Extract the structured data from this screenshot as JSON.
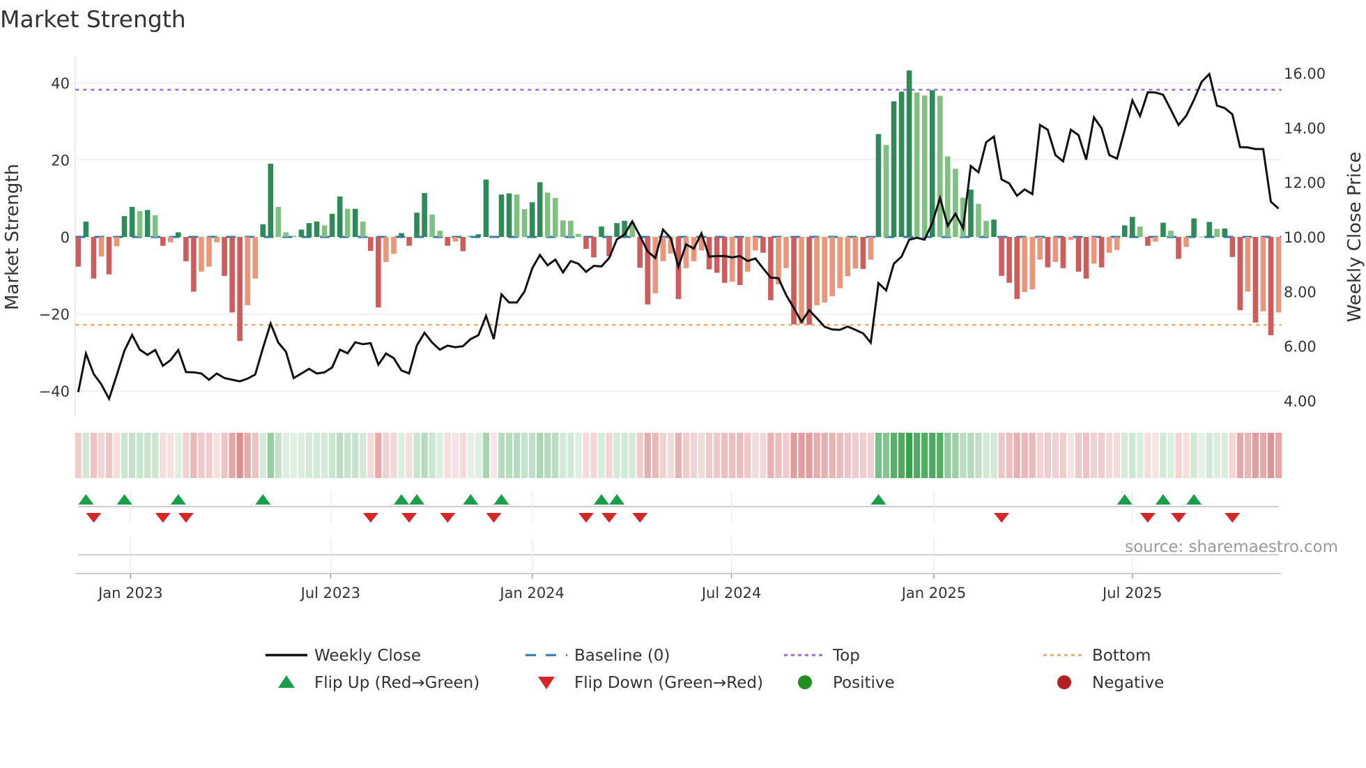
{
  "chart_data": {
    "type": "bar",
    "title": "Market Strength",
    "ylabel": "Market Strength",
    "y2label": "Weekly Close Price",
    "ylim": [
      -47,
      47
    ],
    "y2lim": [
      3.3,
      16.7
    ],
    "yticks": [
      "40",
      "20",
      "0",
      "−20",
      "−40"
    ],
    "ytick_values": [
      40,
      20,
      0,
      -20,
      -40
    ],
    "y2ticks": [
      "16.00",
      "14.00",
      "12.00",
      "10.00",
      "8.00",
      "6.00",
      "4.00"
    ],
    "y2tick_values": [
      16,
      14,
      12,
      10,
      8,
      6,
      4
    ],
    "x_unit": "week index",
    "xticks": [
      {
        "label": "Jan 2023",
        "week": 6.8
      },
      {
        "label": "Jul 2023",
        "week": 32.8
      },
      {
        "label": "Jan 2024",
        "week": 59.0
      },
      {
        "label": "Jul 2024",
        "week": 84.9
      },
      {
        "label": "Jan 2025",
        "week": 111.2
      },
      {
        "label": "Jul 2025",
        "week": 137.0
      }
    ],
    "top_level": 38.2,
    "bottom_level": -22.8,
    "baseline": 0,
    "series": [
      {
        "name": "Market Strength",
        "type": "bar",
        "values": [
          -7.7,
          4.0,
          -10.8,
          -5.1,
          -9.7,
          -2.4,
          5.4,
          7.8,
          6.7,
          7.0,
          5.6,
          -2.3,
          -1.4,
          1.2,
          -6.3,
          -14.2,
          -9.0,
          -7.7,
          -1.4,
          -10.1,
          -19.6,
          -27.0,
          -17.7,
          -10.8,
          3.3,
          19.0,
          7.8,
          1.2,
          0.3,
          1.9,
          3.6,
          4.0,
          3.0,
          6.0,
          10.5,
          7.3,
          7.3,
          4.0,
          -3.6,
          -18.3,
          -6.5,
          -4.4,
          1.0,
          -2.3,
          6.3,
          11.4,
          5.8,
          1.6,
          -2.3,
          -1.2,
          -3.7,
          0.2,
          0.7,
          14.9,
          -0.1,
          11.0,
          11.3,
          11.0,
          7.2,
          9.0,
          14.2,
          11.5,
          10.1,
          4.3,
          4.2,
          0.8,
          -3.1,
          -5.3,
          2.7,
          -5.0,
          3.6,
          4.2,
          3.7,
          -8.0,
          -17.5,
          -14.6,
          -6.3,
          -4.3,
          -16.1,
          -8.1,
          -6.3,
          -3.5,
          -8.4,
          -9.3,
          -11.9,
          -11.6,
          -12.5,
          -9.0,
          -3.5,
          -4.1,
          -16.4,
          -12.3,
          -8.1,
          -22.7,
          -22.6,
          -22.8,
          -17.7,
          -17.0,
          -15.4,
          -13.3,
          -10.2,
          -8.2,
          -8.3,
          -5.9,
          26.7,
          23.9,
          35.2,
          37.7,
          43.2,
          37.5,
          36.7,
          38.1,
          36.6,
          20.9,
          17.7,
          10.2,
          12.3,
          8.6,
          4.2,
          4.5,
          -10.1,
          -11.9,
          -16.1,
          -14.3,
          -13.6,
          -5.9,
          -7.9,
          -6.5,
          -8.1,
          -0.8,
          -9.0,
          -10.8,
          -6.9,
          -7.9,
          -4.1,
          -3.4,
          3.0,
          5.2,
          2.7,
          -2.3,
          -1.2,
          3.7,
          1.6,
          -5.7,
          -2.6,
          4.8,
          0.1,
          3.9,
          2.1,
          2.2,
          -5.2,
          -19.0,
          -14.2,
          -22.2,
          -19.3,
          -25.5,
          -19.6
        ]
      },
      {
        "name": "Weekly Close",
        "type": "line",
        "axis": "right",
        "values": [
          4.32,
          5.73,
          4.98,
          4.6,
          4.07,
          4.94,
          5.83,
          6.41,
          5.87,
          5.68,
          5.86,
          5.28,
          5.49,
          5.86,
          5.05,
          5.04,
          5.0,
          4.77,
          5.0,
          4.83,
          4.77,
          4.71,
          4.81,
          4.96,
          5.93,
          6.83,
          6.13,
          5.79,
          4.83,
          5.0,
          5.17,
          5.0,
          5.04,
          5.22,
          5.87,
          5.74,
          6.14,
          6.07,
          6.11,
          5.32,
          5.73,
          5.56,
          5.11,
          5.0,
          6.02,
          6.49,
          6.13,
          5.87,
          6.02,
          5.96,
          6.0,
          6.26,
          6.4,
          7.11,
          6.26,
          7.9,
          7.6,
          7.6,
          8.0,
          8.85,
          9.34,
          8.96,
          9.17,
          8.7,
          9.12,
          9.02,
          8.72,
          8.94,
          8.92,
          9.23,
          9.91,
          10.09,
          10.57,
          10.04,
          9.47,
          9.23,
          10.27,
          9.96,
          8.91,
          9.73,
          9.57,
          10.13,
          9.28,
          9.3,
          9.3,
          9.25,
          9.3,
          9.12,
          9.21,
          8.85,
          8.51,
          8.49,
          7.87,
          7.4,
          6.89,
          7.32,
          7.02,
          6.71,
          6.61,
          6.6,
          6.72,
          6.6,
          6.47,
          6.13,
          8.31,
          8.04,
          9.02,
          9.28,
          9.9,
          9.97,
          9.9,
          10.51,
          11.43,
          10.41,
          10.85,
          10.32,
          12.6,
          12.37,
          13.47,
          13.68,
          12.11,
          11.96,
          11.51,
          11.74,
          11.57,
          14.1,
          13.93,
          13.0,
          12.77,
          13.93,
          13.73,
          12.83,
          14.38,
          13.98,
          13.0,
          12.87,
          13.91,
          15.0,
          14.43,
          15.3,
          15.29,
          15.21,
          14.66,
          14.1,
          14.44,
          15.02,
          15.68,
          15.97,
          14.81,
          14.72,
          14.49,
          13.29,
          13.28,
          13.22,
          13.22,
          11.29,
          11.04
        ]
      }
    ],
    "legend": {
      "placement": "bottom-center",
      "items": [
        {
          "label": "Weekly Close",
          "symbol": "line",
          "color": "#111111"
        },
        {
          "label": "Baseline (0)",
          "symbol": "dash",
          "color": "#2e75b0"
        },
        {
          "label": "Top",
          "symbol": "dot",
          "color": "#a066e0"
        },
        {
          "label": "Bottom",
          "symbol": "dot",
          "color": "#f0a868"
        },
        {
          "label": "Flip Up (Red→Green)",
          "symbol": "triangle-up",
          "color": "#1a9e4a"
        },
        {
          "label": "Flip Down (Green→Red)",
          "symbol": "triangle-down",
          "color": "#d62728"
        },
        {
          "label": "Positive",
          "symbol": "circle",
          "color": "#228b22"
        },
        {
          "label": "Negative",
          "symbol": "circle",
          "color": "#b22222"
        }
      ]
    },
    "colors": {
      "pos_strong": "#2e8b57",
      "pos_weak": "#80c080",
      "neg_strong": "#cd5c5c",
      "neg_weak": "#e9967a",
      "heat_pos": "#3aa04e",
      "heat_neg": "#cd5a5a"
    },
    "source": "source: sharemaestro.com"
  }
}
